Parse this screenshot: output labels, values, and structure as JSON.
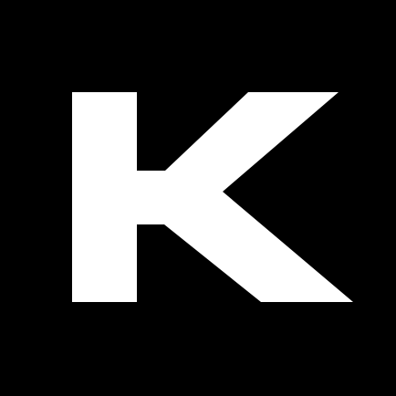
{
  "logo": {
    "glyph": "K",
    "icon": "letter-k-logo"
  },
  "colors": {
    "background": "#000000",
    "foreground": "#ffffff"
  }
}
